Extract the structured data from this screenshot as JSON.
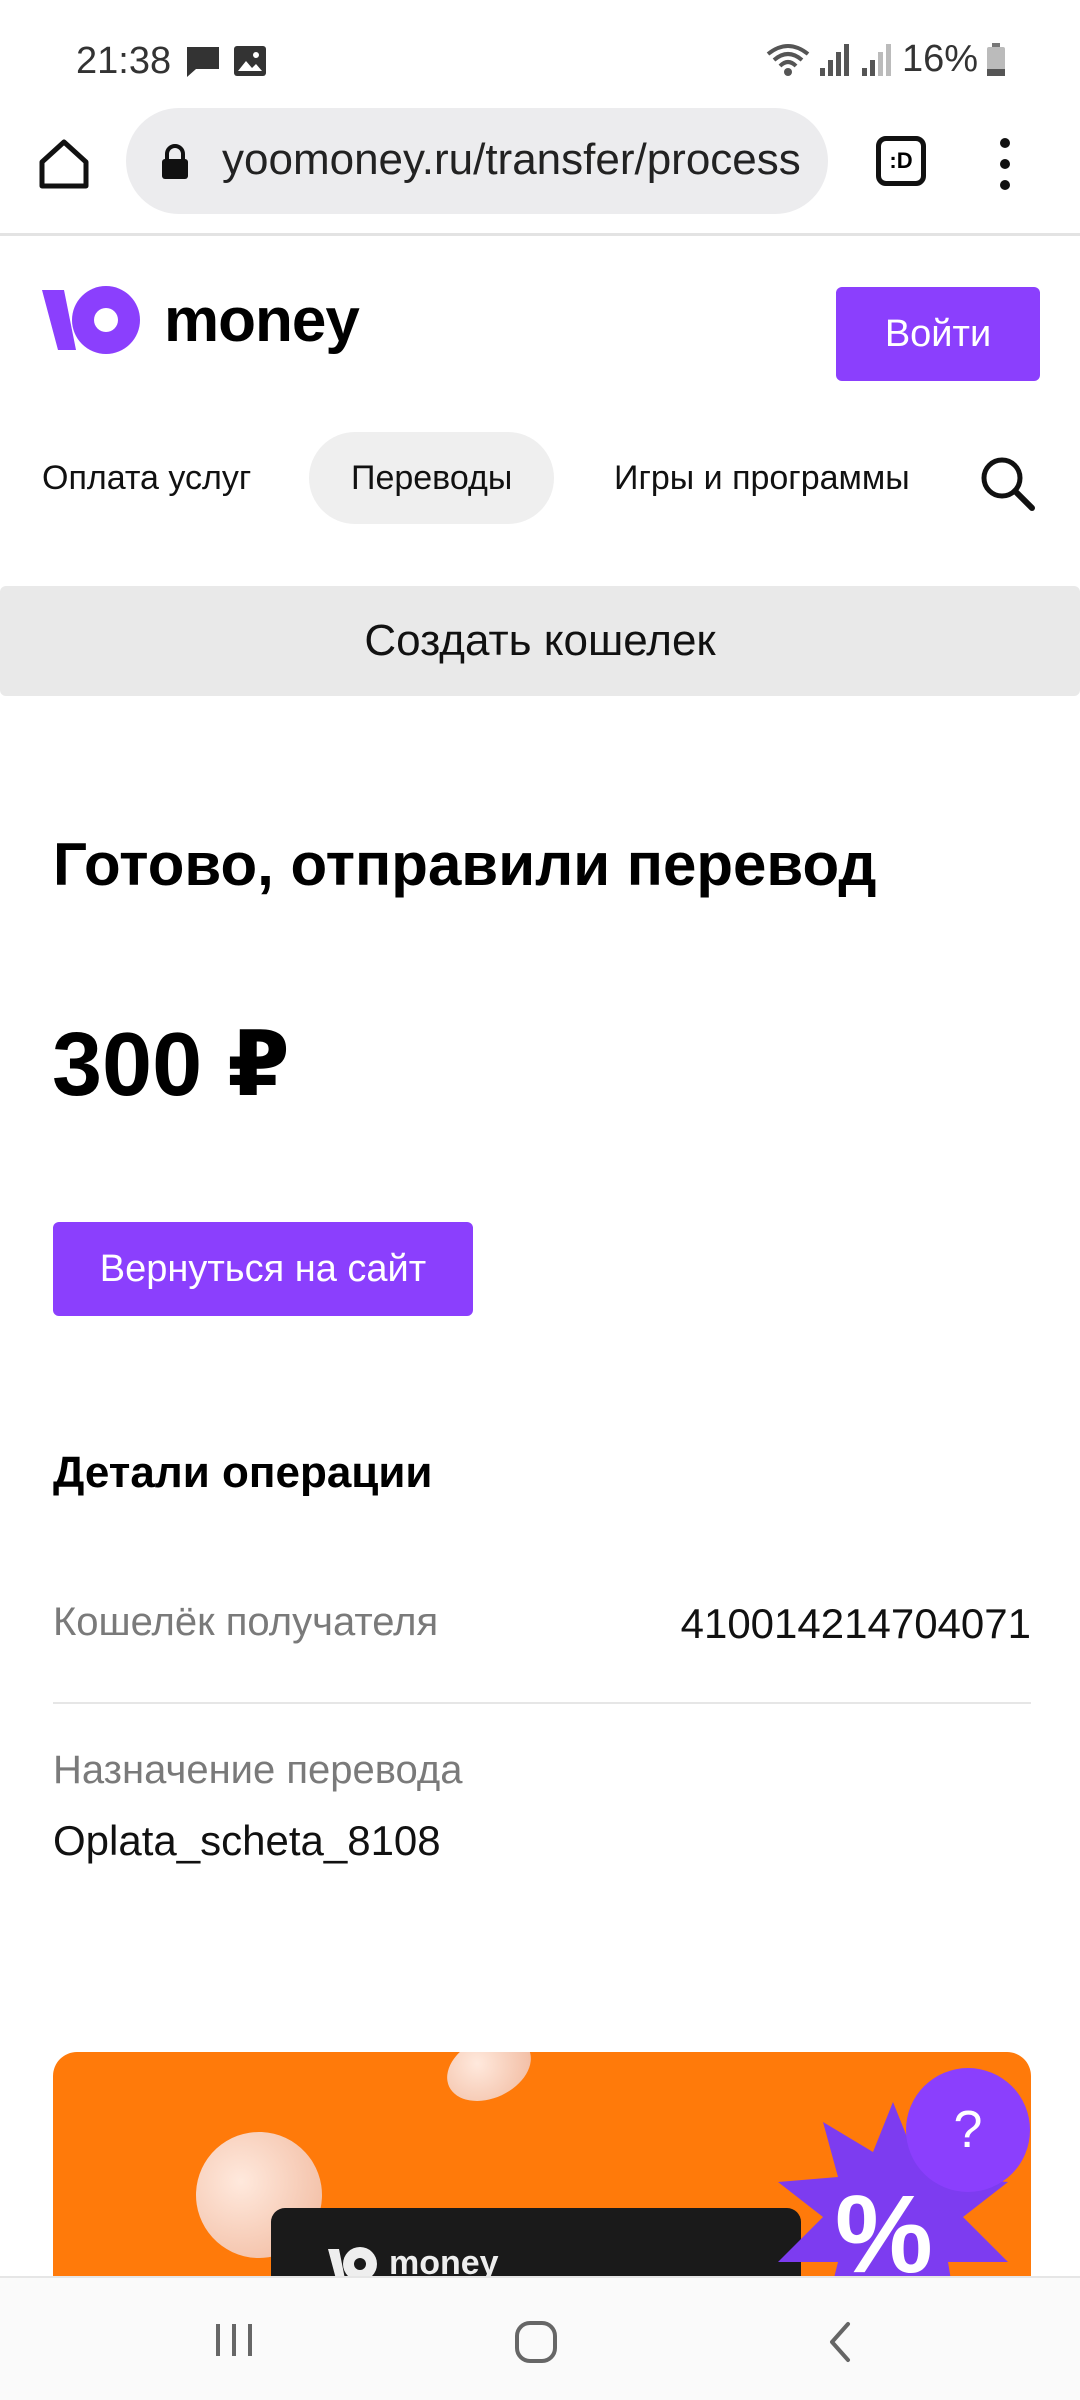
{
  "status_bar": {
    "time": "21:38",
    "battery": "16%",
    "icons": [
      "message-icon",
      "image-icon",
      "wifi-icon",
      "signal-icon",
      "signal-icon",
      "battery-icon"
    ]
  },
  "browser": {
    "url": "yoomoney.ru/transfer/process",
    "tab_label": ":D"
  },
  "header": {
    "logo_text": "money",
    "login_label": "Войти"
  },
  "nav": {
    "items": [
      {
        "label": "Оплата услуг"
      },
      {
        "label": "Переводы"
      },
      {
        "label": "Игры и программы"
      }
    ],
    "active_index": 1
  },
  "create_wallet_label": "Создать кошелек",
  "main": {
    "title": "Готово, отправили перевод",
    "amount": "300 ₽",
    "back_button": "Вернуться на сайт"
  },
  "details": {
    "title": "Детали операции",
    "recipient_label": "Кошелёк получателя",
    "recipient_value": "410014214704071",
    "purpose_label": "Назначение перевода",
    "purpose_value": "Oplata_scheta_8108"
  },
  "banner": {
    "card_logo_text": "money",
    "badge_symbol": "%"
  },
  "help_button": "?",
  "colors": {
    "accent": "#8b3ffd",
    "banner": "#ff7a0a"
  }
}
